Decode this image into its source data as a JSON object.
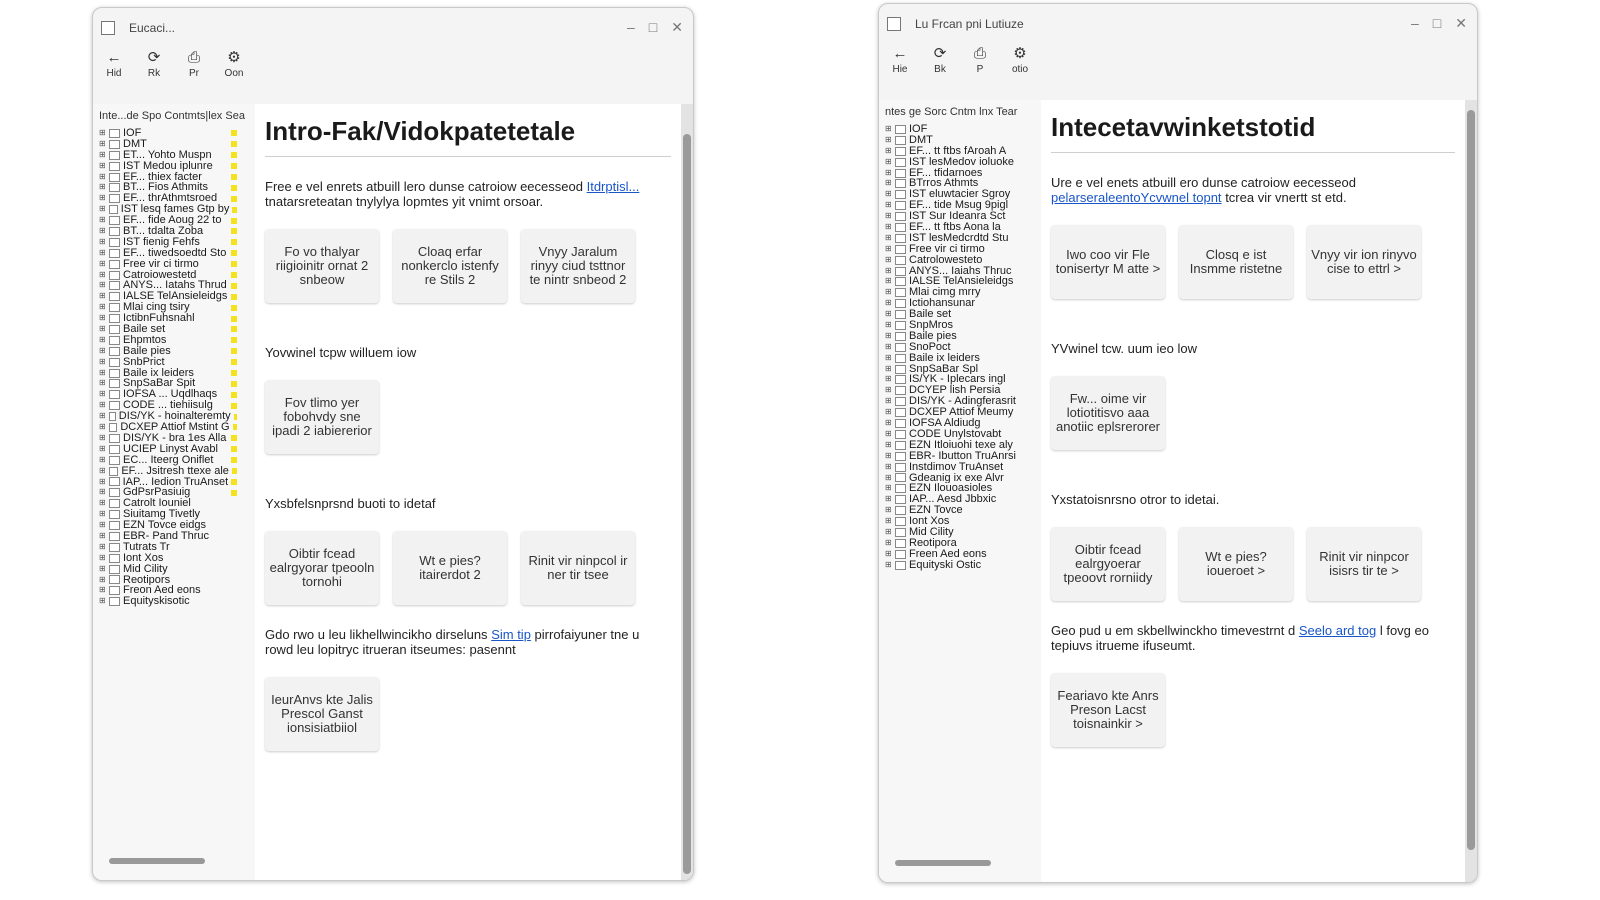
{
  "windows": [
    {
      "title": "Eucaci...",
      "toolbar": [
        {
          "icon": "arrow-left-icon",
          "glyph": "←",
          "label": "Hid"
        },
        {
          "icon": "refresh-icon",
          "glyph": "⟳",
          "label": "Rk"
        },
        {
          "icon": "print-icon",
          "glyph": "⎙",
          "label": "Pr"
        },
        {
          "icon": "options-icon",
          "glyph": "⚙",
          "label": "Oon"
        }
      ],
      "sidebar_header": "Inte...de Spo Contmts|lex Sea",
      "tree": [
        "IOF",
        "DMT",
        "ET... Yohto Muspn",
        "IST Medou iplunre",
        "EF... thiex facter",
        "BT... Fios Athmits",
        "EF... thrAthmtsroed",
        "IST lesq fames Gtp by",
        "EF... fide Aoug 22 to",
        "BT... tdalta Zoba",
        "IST fienig Fehfs",
        "EF... tiwedsoedtd Sto",
        "Free vir ci tirmo",
        "Catroiowestetd",
        "ANYS... Iatahs Thrud",
        "IALSE TelAnsieleidgs",
        "Mlai cing tsiry",
        "IctibnFuhsnahl",
        "Baile set",
        "Ehpmtos",
        "Baile pies",
        "SnbPrict",
        "Baile ix leiders",
        "SnpSaBar Spit",
        "IOFSA ... Uqdlhaqs",
        "CODE ... tiehiisulg",
        "DIS/YK - hoinalteremty",
        "DCXEP Attiof Mstint G",
        "DIS/YK - bra 1es Alla",
        "UCIEP Linyst Avabl",
        "EC... Iteerg Oniflet",
        "EF... Jsitresh ttexe ale",
        "IAP... Iedion TruAnset",
        "GdPsrPasiuig",
        "Catrolt Iouniel",
        "Siuitamg Tivetly",
        "EZN Tovce eidgs",
        "EBR- Pand Thruc",
        "Tutrats Tr",
        "Iont Xos",
        "Mid Cility",
        "Reotipors",
        "Freon Aed eons",
        "Equityskisotic"
      ],
      "content": {
        "title": "Intro-Fak/Vidokpatetetale",
        "sections": [
          {
            "intro": "Free e vel enrets atbuill lero dunse catroiow eecesseod",
            "link": "Itdrptisl...",
            "intro_after": "tnatarsreteatan tnylylya lopmtes yit vnimt orsoar.",
            "label": "",
            "cards": [
              "Fo vo thalyar riigioinitr ornat 2 snbeow",
              "Cloaq erfar nonkerclo istenfy re Stils 2",
              "Vnyy Jaralum rinyy ciud tsttnor te nintr snbeod 2"
            ]
          },
          {
            "intro": "",
            "link": "",
            "intro_after": "",
            "label": "Yovwinel tcpw willuem iow",
            "cards": [
              "Fov tlimo yer fobohvdy sne ipadi 2 iabiererior"
            ]
          },
          {
            "intro": "",
            "link": "",
            "intro_after": "",
            "label": "Yxsbfelsnprsnd buoti to idetaf",
            "cards": [
              "Oibtir fcead ealrgyorar tpeooln tornohi",
              "Wt e pies? itairerdot 2",
              "Rinit vir ninpcol ir ner tir tsee"
            ]
          },
          {
            "intro": "Gdo rwo u leu likhellwincikho dirseluns",
            "link": "Sim tip",
            "intro_after": "pirrofaiyuner tne u rowd leu lopitryc itrueran itseumes: pasennt",
            "label": "",
            "cards": [
              "IeurAnvs kte Jalis Prescol Ganst ionsisiatbiiol"
            ]
          }
        ]
      }
    },
    {
      "title": "Lu Frcan pni Lutiuze",
      "toolbar": [
        {
          "icon": "arrow-left-icon",
          "glyph": "←",
          "label": "Hie"
        },
        {
          "icon": "refresh-icon",
          "glyph": "⟳",
          "label": "Bk"
        },
        {
          "icon": "print-icon",
          "glyph": "⎙",
          "label": "P"
        },
        {
          "icon": "options-icon",
          "glyph": "⚙",
          "label": "otio"
        }
      ],
      "sidebar_header": "ntes ge Sorc Cntm lnx Tear",
      "tree": [
        "IOF",
        "DMT",
        "EF... tt ftbs fAroah A",
        "IST lesMedov ioluoke",
        "EF... tfidarnoes",
        "BTrros Athmts",
        "IST eluwtacier Sgroy",
        "EF... tide Msug 9pigl",
        "IST Sur Ideanra Sct",
        "EF... tt ftbs Aona la",
        "IST lesMedcrdtd Stu",
        "Free vir ci tirmo",
        "Catrolowesteto",
        "ANYS... Iaiahs Thruc",
        "IALSE TelAnsieleidgs",
        "Mlai cimg mrry",
        "Ictiohansunar",
        "Baile set",
        "SnpMros",
        "Baile pies",
        "SnoPoct",
        "Baile ix leiders",
        "SnpSaBar Spl",
        "IS/YK - Iplecars ingl",
        "DCYEP lish Persia",
        "DIS/YK - Adingferasrit",
        "DCXEP Attiof Meumy",
        "IOFSA Aldiudg",
        "CODE Unylstovabt",
        "EZN Itloiuohi texe aly",
        "EBR- Ibutton TruAnrsi",
        "Instdimov TruAnset",
        "Gdeanig ix exe Alvr",
        "EZN Ilouoasioles",
        "IAP... Aesd Jbbxic",
        "EZN Tovce",
        "Iont Xos",
        "Mid Cility",
        "Reotipora",
        "Freen Aed eons",
        "Equityski Ostic"
      ],
      "content": {
        "title": "Intecetavwinketstotid",
        "sections": [
          {
            "intro": "Ure e vel enets atbuill ero dunse catroiow eecesseod",
            "link": "pelarseraleentoYcvwnel topnt",
            "intro_after": "tcrea vir vnertt st etd.",
            "label": "",
            "cards": [
              "Iwo coo vir Fle tonisertyr M atte >",
              "Closq e ist Insmme ristetne",
              "Vnyy vir ion rinyvo cise to ettrl >"
            ]
          },
          {
            "intro": "",
            "link": "",
            "intro_after": "",
            "label": "YVwinel tcw. uum ieo low",
            "cards": [
              "Fw... oime vir lotiotitisvo aaa anotiic eplsrerorer"
            ]
          },
          {
            "intro": "",
            "link": "",
            "intro_after": "",
            "label": "Yxstatoisnrsno otror to idetai.",
            "cards": [
              "Oibtir fcead ealrgyoerar tpeoovt rorniidy",
              "Wt e pies? ioueroet >",
              "Rinit vir ninpcor isisrs tir te >"
            ]
          },
          {
            "intro": "Geo pud u em skbellwinckho timevestrnt d",
            "link": "Seelo ard tog",
            "intro_after": "l fovg eo tepiuvs itrueme ifuseumt.",
            "label": "",
            "cards": [
              "Feariavo kte Anrs Preson Lacst toisnainkir >"
            ]
          }
        ]
      }
    }
  ]
}
